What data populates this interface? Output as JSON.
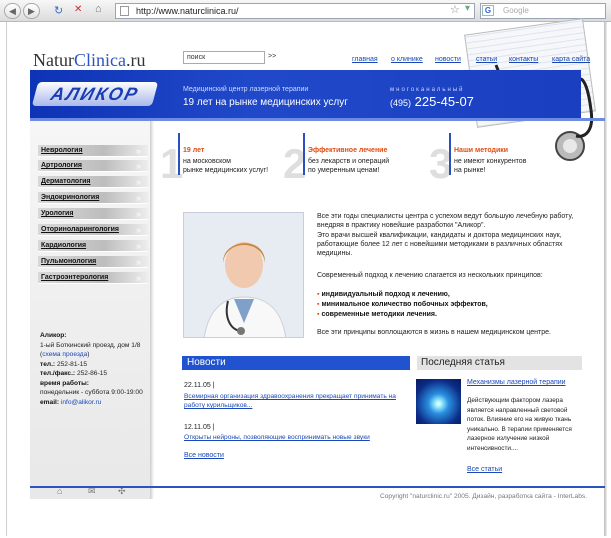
{
  "browser": {
    "url": "http://www.naturclinica.ru/",
    "search_placeholder": "Google"
  },
  "header": {
    "logo_part1": "Natur",
    "logo_part2": "Clinica",
    "logo_part3": ".ru",
    "search_value": "поиск",
    "search_go": ">>",
    "nav": [
      "главная",
      "о клинике",
      "новости",
      "статьи",
      "контакты",
      "карта сайта"
    ]
  },
  "banner": {
    "brand": "АЛИКОР",
    "caption1": "Медицинский центр лазерной терапии",
    "caption2": "19 лет на рынке медицинских услуг",
    "phone_label": "многоканальный",
    "phone_code": "(495)",
    "phone_number": "225-45-07"
  },
  "menu": [
    "Неврология",
    "Артрология",
    "Дерматология",
    "Эндокринология",
    "Урология",
    "Оториноларингология",
    "Кардиология",
    "Пульмонология",
    "Гастроэнтерология"
  ],
  "contacts": {
    "title": "Аликор:",
    "address": "1-ый Боткинский проезд, дом 1/8",
    "scheme": "схема проезда",
    "tel_label": "тел.:",
    "tel": "252-81-15",
    "fax_label": "тел./факс.:",
    "fax": "252-86-15",
    "hours_label": "время работы:",
    "hours": "понедельник - суббота 9:00-19:00",
    "email_label": "email:",
    "email": "info@alikor.ru"
  },
  "points": [
    {
      "num": "1",
      "title": "19 лет",
      "text1": "на московском",
      "text2": "рынке медицинских услуг!"
    },
    {
      "num": "2",
      "title": "Эффективное лечение",
      "text1": "без лекарств и операций",
      "text2": "по умеренным ценам!"
    },
    {
      "num": "3",
      "title": "Наши методики",
      "text1": "не имеют конкурентов",
      "text2": "на рынке!"
    }
  ],
  "intro": {
    "p1": "Все эти годы специалисты центра с успехом ведут большую лечебную работу, внедряя в практику новейшие разработки \"Аликор\".",
    "p2": "Это врачи высшей квалификации, кандидаты и доктора медицинских наук, работающие более 12 лет с новейшими методиками в различных областях медицины.",
    "principles": "Современный подход к лечению слагается из нескольких принципов:",
    "bullets": [
      "индивидуальный подход к лечению,",
      "минимальное количество побочных эффектов,",
      "современные методики лечения."
    ],
    "closing": "Все эти принципы воплощаются в жизнь в нашем медицинском центре."
  },
  "news": {
    "title": "Новости",
    "items": [
      {
        "date": "22.11.05 |",
        "text": "Всемирная организация здравоохранения прекращает принимать на работу курильщиков..."
      },
      {
        "date": "12.11.05 |",
        "text": "Открыты нейроны, позволяющие воспринимать новые звуки"
      }
    ],
    "all": "Все новости"
  },
  "article": {
    "title": "Последняя статья",
    "link": "Механизмы лазерной терапии",
    "text": "Действующим фактором лазера является направленный световой поток. Влияние его на живую ткань уникально. В терапии применяется лазерное излучение низкой интенсивности....",
    "all": "Все статьи"
  },
  "footer": {
    "copyright": "Copyright \"naturclinic.ru\" 2005. Дизайн, разработка сайта - InterLabs."
  }
}
